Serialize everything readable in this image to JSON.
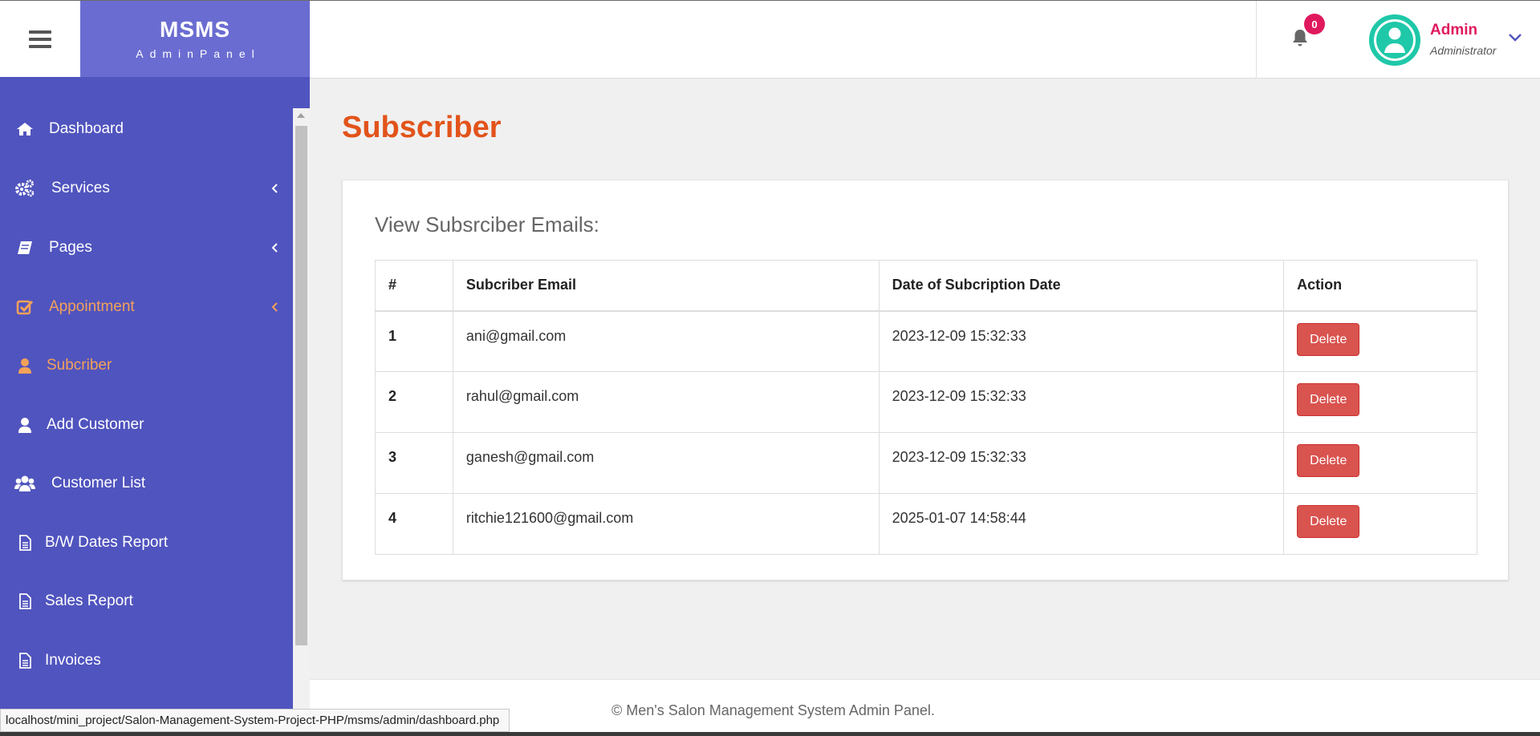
{
  "brand": {
    "title": "MSMS",
    "subtitle": "AdminPanel"
  },
  "header": {
    "notification_count": "0",
    "user_name": "Admin",
    "user_role": "Administrator"
  },
  "sidebar": {
    "items": [
      {
        "label": "Dashboard",
        "icon": "home-icon",
        "has_submenu": false,
        "active": false
      },
      {
        "label": "Services",
        "icon": "cogs-icon",
        "has_submenu": true,
        "active": false
      },
      {
        "label": "Pages",
        "icon": "book-icon",
        "has_submenu": true,
        "active": false
      },
      {
        "label": "Appointment",
        "icon": "check-square-icon",
        "has_submenu": true,
        "active": true
      },
      {
        "label": "Subcriber",
        "icon": "user-icon",
        "has_submenu": false,
        "active": true
      },
      {
        "label": "Add Customer",
        "icon": "user-icon",
        "has_submenu": false,
        "active": false
      },
      {
        "label": "Customer List",
        "icon": "users-icon",
        "has_submenu": false,
        "active": false
      },
      {
        "label": "B/W Dates Report",
        "icon": "file-icon",
        "has_submenu": false,
        "active": false
      },
      {
        "label": "Sales Report",
        "icon": "file-icon",
        "has_submenu": false,
        "active": false
      },
      {
        "label": "Invoices",
        "icon": "file-icon",
        "has_submenu": false,
        "active": false
      }
    ]
  },
  "main": {
    "title": "Subscriber",
    "panel_heading": "View Subsrciber Emails:",
    "table": {
      "headers": [
        "#",
        "Subcriber Email",
        "Date of Subcription Date",
        "Action"
      ],
      "rows": [
        {
          "num": "1",
          "email": "ani@gmail.com",
          "date": "2023-12-09 15:32:33",
          "action": "Delete"
        },
        {
          "num": "2",
          "email": "rahul@gmail.com",
          "date": "2023-12-09 15:32:33",
          "action": "Delete"
        },
        {
          "num": "3",
          "email": "ganesh@gmail.com",
          "date": "2023-12-09 15:32:33",
          "action": "Delete"
        },
        {
          "num": "4",
          "email": "ritchie121600@gmail.com",
          "date": "2025-01-07 14:58:44",
          "action": "Delete"
        }
      ]
    }
  },
  "footer": {
    "text": "© Men's Salon Management System Admin Panel."
  },
  "status_bar": {
    "url": "localhost/mini_project/Salon-Management-System-Project-PHP/msms/admin/dashboard.php"
  },
  "colors": {
    "sidebar_bg": "#5054be",
    "brand_bg": "#6a6cd1",
    "active_nav": "#f4a259",
    "title": "#e2531a",
    "danger": "#d9534f",
    "badge": "#e0195e",
    "avatar": "#1fc8a8"
  }
}
